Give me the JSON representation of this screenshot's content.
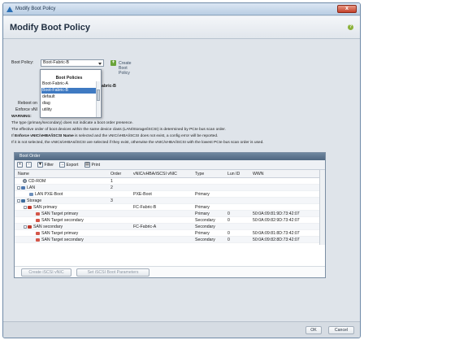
{
  "window": {
    "title": "Modify Boot Policy",
    "close_label": "x"
  },
  "header": {
    "title": "Modify Boot Policy",
    "help_label": "?"
  },
  "policy": {
    "label": "Boot Policy:",
    "selected": "Boot-Fabric-B",
    "create_label": "Create Boot Policy",
    "partial_name": "abric-B",
    "partial_reboot": "Reboot on",
    "partial_enforce": "Enforce vNI"
  },
  "dropdown": {
    "header": "Boot Policies",
    "items": [
      "Boot-Fabric-A",
      "Boot-Fabric-B",
      "default",
      "diag",
      "utility"
    ],
    "selected_index": 1
  },
  "warnings": {
    "title": "WARNING:",
    "line1": "The type (primary/secondary) does not indicate a boot order presence.",
    "line2": "The effective order of boot devices within the same device class (LAN/Storage/iSCSI) is determined by PCIe bus scan order.",
    "line3_bold": "Enforce vNIC/vHBA/iSCSI Name",
    "line3_prefix": "If ",
    "line3_suffix": " is selected and the vNIC/vHBA/iSCSI does not exist, a config error will be reported.",
    "line4": "If it is not selected, the vNICs/vHBAs/iSCSI are selected if they exist, otherwise the vNIC/vHBA/iSCSI with the lowest PCIe bus scan order is used."
  },
  "boot_order": {
    "title": "Boot Order",
    "toolbar": {
      "filter": "Filter",
      "export": "Export",
      "print": "Print"
    },
    "columns": [
      "Name",
      "Order",
      "vNIC/vHBA/iSCSI vNIC",
      "Type",
      "Lun ID",
      "WWN"
    ],
    "rows": [
      {
        "name": "CD-ROM",
        "order": "1",
        "vnic": "",
        "type": "",
        "lun": "",
        "wwn": ""
      },
      {
        "name": "LAN",
        "order": "2",
        "vnic": "",
        "type": "",
        "lun": "",
        "wwn": ""
      },
      {
        "name": "LAN PXE-Boot",
        "order": "",
        "vnic": "PXE-Boot",
        "type": "Primary",
        "lun": "",
        "wwn": ""
      },
      {
        "name": "Storage",
        "order": "3",
        "vnic": "",
        "type": "",
        "lun": "",
        "wwn": ""
      },
      {
        "name": "SAN primary",
        "order": "",
        "vnic": "FC-Fabric-B",
        "type": "Primary",
        "lun": "",
        "wwn": ""
      },
      {
        "name": "SAN Target primary",
        "order": "",
        "vnic": "",
        "type": "Primary",
        "lun": "0",
        "wwn": "50:0A:09:81:9D:73:42:07"
      },
      {
        "name": "SAN Target secondary",
        "order": "",
        "vnic": "",
        "type": "Secondary",
        "lun": "0",
        "wwn": "50:0A:09:82:9D:73:42:07"
      },
      {
        "name": "SAN secondary",
        "order": "",
        "vnic": "FC-Fabric-A",
        "type": "Secondary",
        "lun": "",
        "wwn": ""
      },
      {
        "name": "SAN Target primary",
        "order": "",
        "vnic": "",
        "type": "Primary",
        "lun": "0",
        "wwn": "50:0A:09:81:8D:73:42:07"
      },
      {
        "name": "SAN Target secondary",
        "order": "",
        "vnic": "",
        "type": "Secondary",
        "lun": "0",
        "wwn": "50:0A:09:82:8D:73:42:07"
      }
    ],
    "create_iscsi": "Create iSCSI vNIC",
    "set_iscsi": "Set iSCSI Boot Parameters"
  },
  "footer": {
    "ok": "OK",
    "cancel": "Cancel"
  }
}
